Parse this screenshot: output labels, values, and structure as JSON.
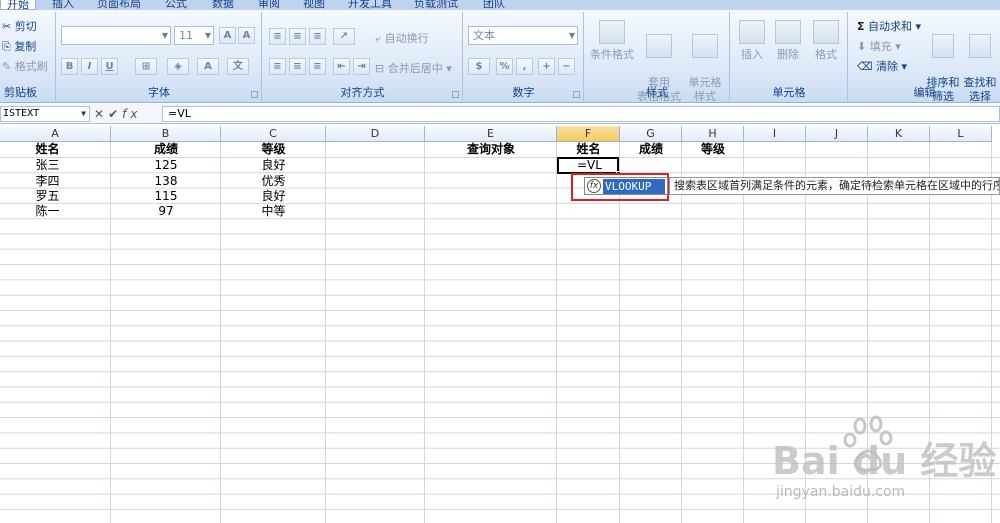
{
  "ribbon": {
    "tabs": [
      "开始",
      "插入",
      "页面布局",
      "公式",
      "数据",
      "审阅",
      "视图",
      "开发工具",
      "负载测试",
      "团队"
    ],
    "clipboard": {
      "label": "剪贴板",
      "cut": "剪切",
      "copy": "复制",
      "format_painter": "格式刷"
    },
    "font": {
      "label": "字体",
      "font_name": "",
      "font_size": "11"
    },
    "alignment": {
      "label": "对齐方式",
      "wrap_text": "自动换行",
      "merge_center": "合并后居中"
    },
    "number": {
      "label": "数字",
      "format": "文本"
    },
    "styles": {
      "label": "样式",
      "conditional_format": "条件格式",
      "table_format": "套用\n表格格式",
      "cell_styles": "单元格\n样式"
    },
    "cells": {
      "label": "单元格",
      "insert": "插入",
      "delete": "删除",
      "format": "格式"
    },
    "editing": {
      "label": "编辑",
      "autosum": "自动求和",
      "fill": "填充",
      "clear": "清除",
      "sort_filter": "排序和\n筛选",
      "find_select": "查找和\n选择"
    }
  },
  "formula_bar": {
    "name_box": "ISTEXT",
    "formula": "=VL"
  },
  "grid": {
    "columns": [
      "A",
      "B",
      "C",
      "D",
      "E",
      "F",
      "G",
      "H",
      "I",
      "J",
      "K",
      "L"
    ],
    "headers": {
      "A": "姓名",
      "B": "成绩",
      "C": "等级",
      "E": "查询对象",
      "F": "姓名",
      "G": "成绩",
      "H": "等级"
    },
    "rows": [
      {
        "name": "张三",
        "score": "125",
        "grade": "良好"
      },
      {
        "name": "李四",
        "score": "138",
        "grade": "优秀"
      },
      {
        "name": "罗五",
        "score": "115",
        "grade": "良好"
      },
      {
        "name": "陈一",
        "score": "97",
        "grade": "中等"
      }
    ],
    "active_cell_value": "=VL"
  },
  "autocomplete": {
    "item": "VLOOKUP",
    "tooltip": "搜索表区域首列满足条件的元素，确定待检索单元格在区域中的行序号，"
  },
  "watermark": {
    "logo": "Bai du 经验",
    "url": "jingyan.baidu.com"
  }
}
